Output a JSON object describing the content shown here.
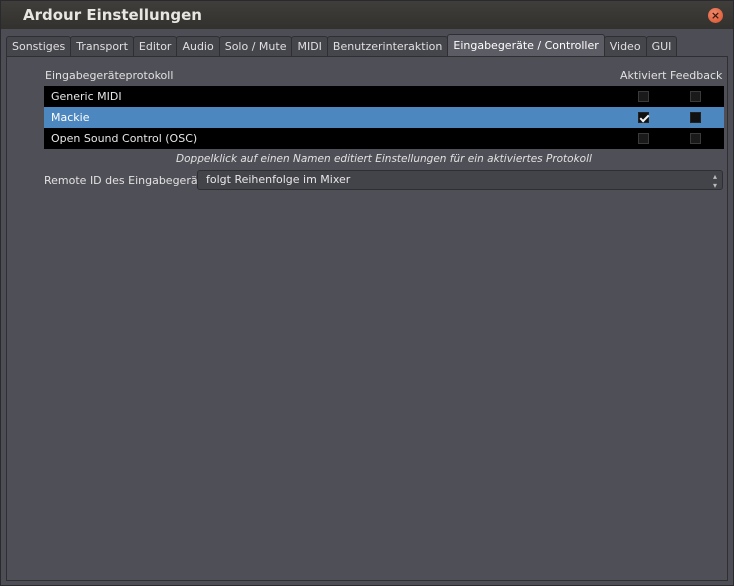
{
  "window": {
    "title": "Ardour Einstellungen"
  },
  "tabs": [
    {
      "label": "Sonstiges"
    },
    {
      "label": "Transport"
    },
    {
      "label": "Editor"
    },
    {
      "label": "Audio"
    },
    {
      "label": "Solo / Mute"
    },
    {
      "label": "MIDI"
    },
    {
      "label": "Benutzerinteraktion"
    },
    {
      "label": "Eingabegeräte / Controller",
      "active": true
    },
    {
      "label": "Video"
    },
    {
      "label": "GUI"
    }
  ],
  "table": {
    "columns": {
      "protocol": "Eingabegeräteprotokoll",
      "enabled": "Aktiviert",
      "feedback": "Feedback"
    },
    "rows": [
      {
        "name": "Generic MIDI",
        "enabled": false,
        "feedback": false,
        "selected": false
      },
      {
        "name": "Mackie",
        "enabled": true,
        "feedback": false,
        "selected": true
      },
      {
        "name": "Open Sound Control (OSC)",
        "enabled": false,
        "feedback": false,
        "selected": false
      }
    ]
  },
  "hint": "Doppelklick auf einen Namen editiert Einstellungen für ein aktiviertes Protokoll",
  "remote_id": {
    "label": "Remote ID des Eingabegeräts:",
    "value": "folgt Reihenfolge im Mixer"
  },
  "colors": {
    "selection": "#4d87c0",
    "close_button": "#d9502a"
  },
  "icons": {
    "close": "close-icon",
    "check": "check-icon",
    "combo_arrows": "up-down-arrows-icon"
  }
}
